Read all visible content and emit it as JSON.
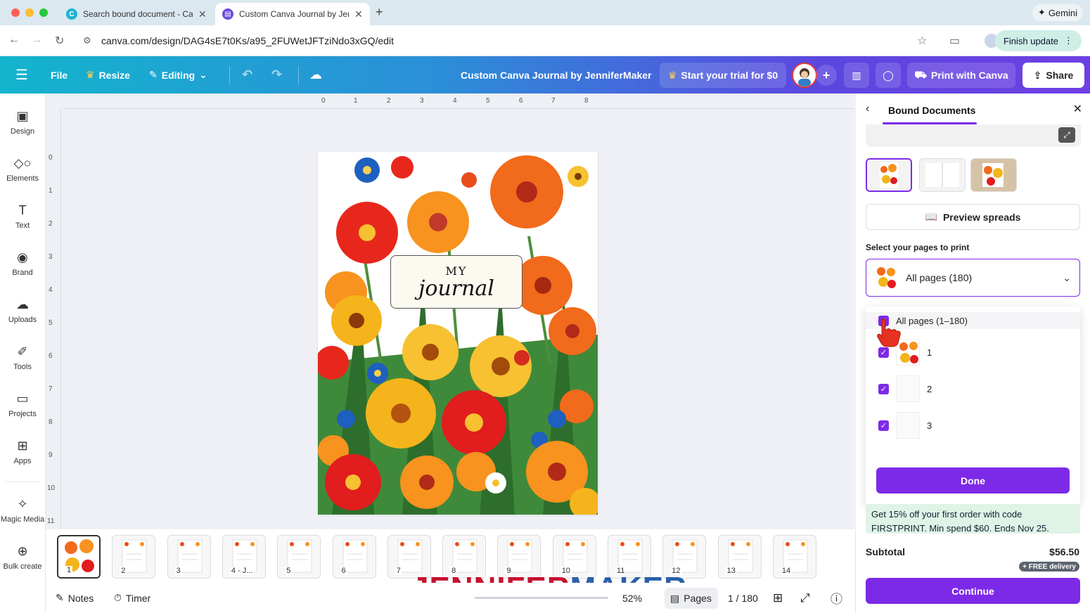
{
  "browser": {
    "tabs": [
      {
        "title": "Search bound document - Ca",
        "favicon": "canva-icon"
      },
      {
        "title": "Custom Canva Journal by Jer",
        "favicon": "canva-print-icon"
      }
    ],
    "gemini_label": "Gemini",
    "url": "canva.com/design/DAG4sE7t0Ks/a95_2FUWetJFTziNdo3xGQ/edit",
    "finish_update_label": "Finish update"
  },
  "header": {
    "file_label": "File",
    "resize_label": "Resize",
    "editing_label": "Editing",
    "doc_title": "Custom Canva Journal by JenniferMaker",
    "trial_label": "Start your trial for $0",
    "print_label": "Print with Canva",
    "share_label": "Share"
  },
  "sidebar": {
    "items": [
      {
        "label": "Design",
        "icon": "design-icon"
      },
      {
        "label": "Elements",
        "icon": "elements-icon"
      },
      {
        "label": "Text",
        "icon": "text-icon"
      },
      {
        "label": "Brand",
        "icon": "brand-icon"
      },
      {
        "label": "Uploads",
        "icon": "uploads-icon"
      },
      {
        "label": "Tools",
        "icon": "tools-icon"
      },
      {
        "label": "Projects",
        "icon": "projects-icon"
      },
      {
        "label": "Apps",
        "icon": "apps-icon"
      },
      {
        "label": "Magic Media",
        "icon": "magic-media-icon"
      },
      {
        "label": "Bulk create",
        "icon": "bulk-create-icon"
      }
    ]
  },
  "rulers": {
    "top": [
      "0",
      "1",
      "2",
      "3",
      "4",
      "5",
      "6",
      "7",
      "8"
    ],
    "left": [
      "0",
      "1",
      "2",
      "3",
      "4",
      "5",
      "6",
      "7",
      "8",
      "9",
      "10",
      "11"
    ]
  },
  "canvas": {
    "label_top": "MY",
    "label_bottom": "journal"
  },
  "filmstrip": {
    "pages": [
      "1",
      "2",
      "3",
      "4 - J...",
      "5",
      "6",
      "7",
      "8",
      "9",
      "10",
      "11",
      "12",
      "13",
      "14"
    ]
  },
  "bottom": {
    "notes_label": "Notes",
    "timer_label": "Timer",
    "zoom": "52%",
    "pages_label": "Pages",
    "page_counter": "1 / 180",
    "watermark_a": "JENNIFER",
    "watermark_b": "MAKER"
  },
  "panel": {
    "title": "Bound Documents",
    "preview_spreads_label": "Preview spreads",
    "select_label": "Select your pages to print",
    "dropdown_value": "All pages (180)",
    "all_pages_option": "All pages (1–180)",
    "page_options": [
      "1",
      "2",
      "3"
    ],
    "done_label": "Done",
    "promo_text": "Get 15% off your first order with code FIRSTPRINT. Min spend $60. Ends Nov 25.",
    "subtotal_label": "Subtotal",
    "subtotal_value": "$56.50",
    "free_delivery": "+ FREE delivery",
    "continue_label": "Continue"
  },
  "colors": {
    "accent": "#7d2ae8",
    "header_start": "#13b4cd",
    "header_end": "#6e3fe3",
    "watermark_red": "#c8102e",
    "watermark_blue": "#2b5fa8"
  }
}
